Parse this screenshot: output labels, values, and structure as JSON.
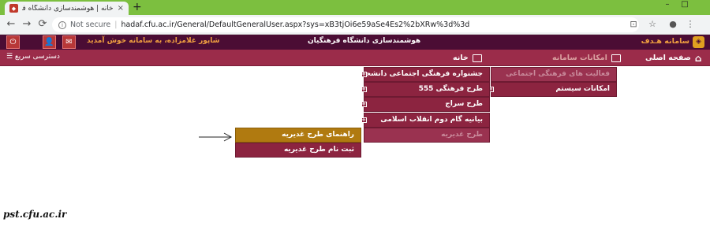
{
  "browser": {
    "tab_title": "خانه | هوشمندسازی دانشگاه فره",
    "tab_close": "×",
    "new_tab": "+",
    "window_controls": [
      "–",
      "□"
    ],
    "nav_icons": [
      "arrow-left-icon",
      "arrow-right-icon",
      "reload-icon"
    ],
    "nav_glyphs": [
      "←",
      "→",
      "⟳"
    ],
    "security_label": "Not secure",
    "separator": "|",
    "url": "hadaf.cfu.ac.ir/General/DefaultGeneralUser.aspx?sys=xB3tjOi6e59aSe4Es2%2bXRw%3d%3d",
    "toolbar_glyphs": [
      "⊡",
      "☆",
      "●",
      "⋮"
    ]
  },
  "header": {
    "welcome": "شاپور غلامزاده، به سامانه خوش آمدید",
    "center_title": "هوشمندسازی دانشگاه فرهنگیان",
    "logo_text": "سامانه هـدف",
    "icon_glyphs": [
      "⏻",
      "👤",
      "✉"
    ]
  },
  "nav": {
    "quick_access": "دسترسی سریع ☰",
    "home_label": "خانه",
    "system_features": "امکانات سامانه",
    "main_page": "صفحه اصلی"
  },
  "menus": {
    "level1": [
      {
        "label": "فعالیت های فرهنگی اجتماعی"
      },
      {
        "label": "امکانات سیستم"
      }
    ],
    "level2": [
      {
        "label": "جشنواره فرهنگی اجتماعی دانشجویان"
      },
      {
        "label": "طرح فرهنگی 555"
      },
      {
        "label": "طرح سراج"
      },
      {
        "label": "بیانیه گام دوم انقلاب اسلامی"
      },
      {
        "label": "طرح غدیریه"
      }
    ],
    "level3": [
      {
        "label": "راهنمای طرح غدیریه"
      },
      {
        "label": "ثبت نام طرح غدیریه"
      }
    ]
  },
  "watermark": "pst.cfu.ac.ir",
  "colors": {
    "header_bg": "#4b0d34",
    "nav_bg": "#9b2c4a",
    "menu_bg": "#8c2440",
    "highlight": "#b07a10",
    "accent": "#f0a040"
  }
}
